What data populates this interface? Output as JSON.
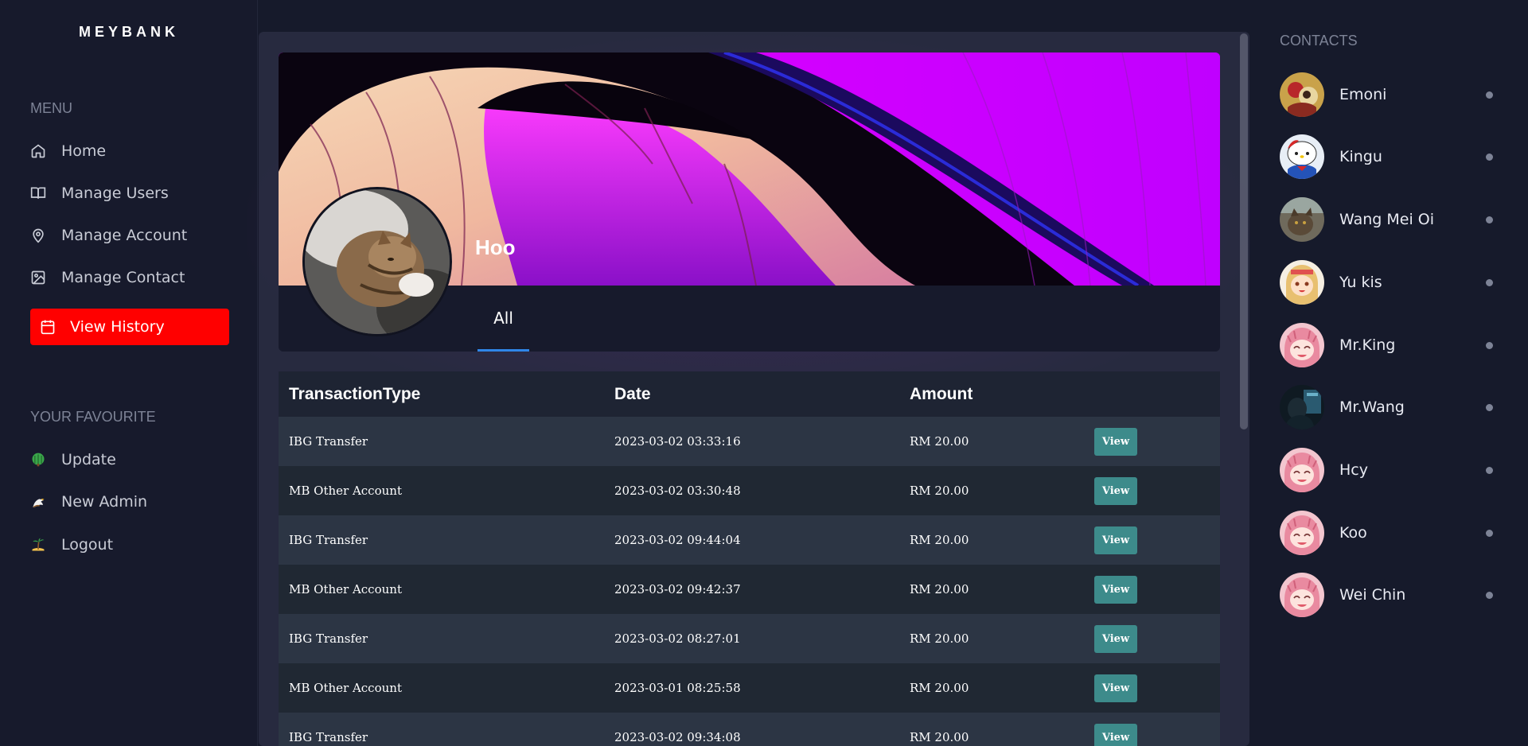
{
  "brand": "MEYBANK",
  "menu": {
    "title": "MENU",
    "items": [
      {
        "label": "Home",
        "icon": "home-icon"
      },
      {
        "label": "Manage Users",
        "icon": "book-icon"
      },
      {
        "label": "Manage Account",
        "icon": "map-pin-icon"
      },
      {
        "label": "Manage Contact",
        "icon": "image-icon"
      },
      {
        "label": "View History",
        "icon": "calendar-icon",
        "active": true
      }
    ]
  },
  "favourites": {
    "title": "YOUR FAVOURITE",
    "items": [
      {
        "label": "Update",
        "icon": "tree-icon"
      },
      {
        "label": "New Admin",
        "icon": "eagle-icon"
      },
      {
        "label": "Logout",
        "icon": "island-icon"
      }
    ]
  },
  "profile": {
    "name": "Hoo",
    "tabs": [
      {
        "label": "All",
        "active": true
      }
    ]
  },
  "table": {
    "headers": [
      "TransactionType",
      "Date",
      "Amount"
    ],
    "action_label": "View",
    "rows": [
      {
        "type": "IBG Transfer",
        "date": "2023-03-02 03:33:16",
        "amount": "RM 20.00"
      },
      {
        "type": "MB Other Account",
        "date": "2023-03-02 03:30:48",
        "amount": "RM 20.00"
      },
      {
        "type": "IBG Transfer",
        "date": "2023-03-02 09:44:04",
        "amount": "RM 20.00"
      },
      {
        "type": "MB Other Account",
        "date": "2023-03-02 09:42:37",
        "amount": "RM 20.00"
      },
      {
        "type": "IBG Transfer",
        "date": "2023-03-02 08:27:01",
        "amount": "RM 20.00"
      },
      {
        "type": "MB Other Account",
        "date": "2023-03-01 08:25:58",
        "amount": "RM 20.00"
      },
      {
        "type": "IBG Transfer",
        "date": "2023-03-02 09:34:08",
        "amount": "RM 20.00"
      }
    ]
  },
  "contacts": {
    "title": "CONTACTS",
    "items": [
      {
        "name": "Emoni"
      },
      {
        "name": "Kingu"
      },
      {
        "name": "Wang Mei Oi"
      },
      {
        "name": "Yu kis"
      },
      {
        "name": "Mr.King"
      },
      {
        "name": "Mr.Wang"
      },
      {
        "name": "Hcy"
      },
      {
        "name": "Koo"
      },
      {
        "name": "Wei Chin"
      }
    ]
  },
  "colors": {
    "accent_active": "#ff0000",
    "view_button": "#3d8b8b",
    "tab_underline": "#2f86e8"
  }
}
